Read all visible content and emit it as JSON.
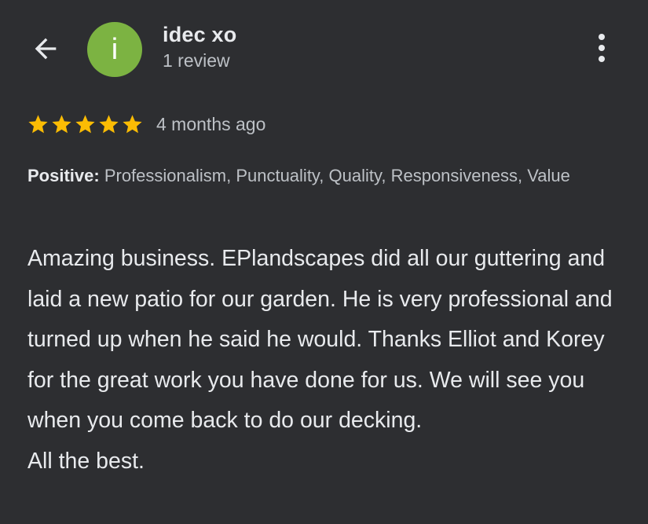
{
  "header": {
    "back_icon": "arrow-back-icon",
    "avatar_letter": "i",
    "avatar_color": "#7cb342",
    "user_name": "idec xo",
    "review_count": "1 review",
    "more_icon": "more-vert-icon"
  },
  "rating": {
    "stars": 5,
    "max_stars": 5,
    "star_color": "#fbbc04",
    "time_ago": "4 months ago"
  },
  "attributes": {
    "label": "Positive:",
    "values": " Professionalism, Punctuality, Quality, Responsiveness, Value"
  },
  "review": {
    "text": "Amazing business. EPlandscapes did all our guttering and laid a new patio for our garden. He is very professional and turned up when he said he would. Thanks Elliot and Korey for the great work you have done for us. We will see you when you come back to do our decking.\nAll the best."
  }
}
